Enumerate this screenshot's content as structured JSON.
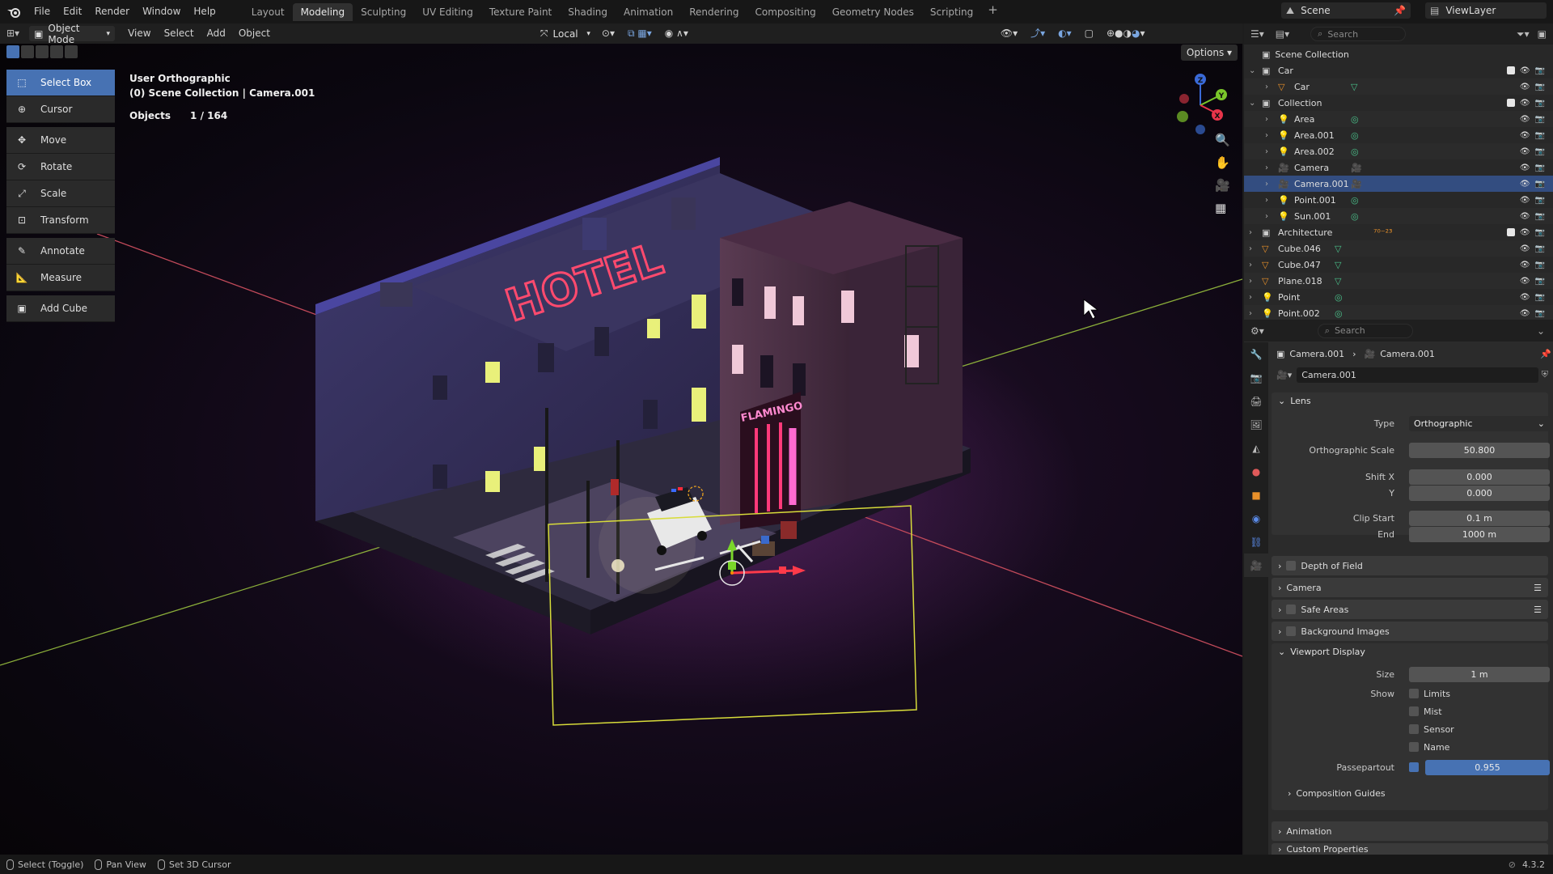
{
  "topbar": {
    "menus": [
      "File",
      "Edit",
      "Render",
      "Window",
      "Help"
    ],
    "workspaces": [
      "Layout",
      "Modeling",
      "Sculpting",
      "UV Editing",
      "Texture Paint",
      "Shading",
      "Animation",
      "Rendering",
      "Compositing",
      "Geometry Nodes",
      "Scripting"
    ],
    "active_workspace": "Modeling",
    "add_tab": "+",
    "scene": "Scene",
    "view_layer": "ViewLayer"
  },
  "viewport_header": {
    "mode": "Object Mode",
    "menus": [
      "View",
      "Select",
      "Add",
      "Object"
    ],
    "orientation": "Local",
    "options": "Options"
  },
  "toolbar": {
    "tools": [
      "Select Box",
      "Cursor",
      "Move",
      "Rotate",
      "Scale",
      "Transform",
      "Annotate",
      "Measure",
      "Add Cube"
    ],
    "active": "Select Box"
  },
  "viewport_info": {
    "view": "User Orthographic",
    "collection": "(0) Scene Collection | Camera.001",
    "objects_label": "Objects",
    "objects_count": "1 / 164"
  },
  "scene_text": {
    "hotel_sign": "HOTEL",
    "flamingo_sign": "FLAMINGO"
  },
  "gizmo": {
    "z": "Z",
    "y": "Y",
    "x": "X"
  },
  "outliner": {
    "search_placeholder": "Search",
    "root": "Scene Collection",
    "rows": [
      {
        "name": "Car",
        "kind": "collection",
        "indent": 0
      },
      {
        "name": "Car",
        "kind": "object",
        "indent": 1
      },
      {
        "name": "Collection",
        "kind": "collection",
        "indent": 0
      },
      {
        "name": "Area",
        "kind": "light",
        "indent": 1
      },
      {
        "name": "Area.001",
        "kind": "light",
        "indent": 1
      },
      {
        "name": "Area.002",
        "kind": "light",
        "indent": 1
      },
      {
        "name": "Camera",
        "kind": "camera",
        "indent": 1
      },
      {
        "name": "Camera.001",
        "kind": "camera",
        "indent": 1
      },
      {
        "name": "Point.001",
        "kind": "light",
        "indent": 1
      },
      {
        "name": "Sun.001",
        "kind": "light",
        "indent": 1
      },
      {
        "name": "Architecture",
        "kind": "collection",
        "indent": 0
      },
      {
        "name": "Cube.046",
        "kind": "mesh",
        "indent": 0
      },
      {
        "name": "Cube.047",
        "kind": "mesh",
        "indent": 0
      },
      {
        "name": "Plane.018",
        "kind": "mesh",
        "indent": 0
      },
      {
        "name": "Point",
        "kind": "light",
        "indent": 0
      },
      {
        "name": "Point.002",
        "kind": "light",
        "indent": 0
      }
    ],
    "selected": "Camera.001",
    "arch_extra": "⁷⁰⁻²³"
  },
  "properties": {
    "search_placeholder": "Search",
    "breadcrumb": [
      "Camera.001",
      "Camera.001"
    ],
    "datablock": "Camera.001",
    "lens": {
      "title": "Lens",
      "type_label": "Type",
      "type_value": "Orthographic",
      "ortho_scale_label": "Orthographic Scale",
      "ortho_scale_value": "50.800",
      "shift_x_label": "Shift X",
      "shift_x_value": "0.000",
      "shift_y_label": "Y",
      "shift_y_value": "0.000",
      "clip_start_label": "Clip Start",
      "clip_start_value": "0.1 m",
      "clip_end_label": "End",
      "clip_end_value": "1000 m"
    },
    "sections": {
      "dof": "Depth of Field",
      "camera": "Camera",
      "safe_areas": "Safe Areas",
      "bg_images": "Background Images",
      "viewport_display": "Viewport Display",
      "composition": "Composition Guides",
      "animation": "Animation",
      "custom": "Custom Properties"
    },
    "viewport_display": {
      "size_label": "Size",
      "size_value": "1 m",
      "show_label": "Show",
      "limits": "Limits",
      "mist": "Mist",
      "sensor": "Sensor",
      "name": "Name",
      "passepartout_label": "Passepartout",
      "passepartout_value": "0.955"
    }
  },
  "statusbar": {
    "items": [
      "Select (Toggle)",
      "Pan View",
      "Set 3D Cursor"
    ],
    "version": "4.3.2"
  }
}
